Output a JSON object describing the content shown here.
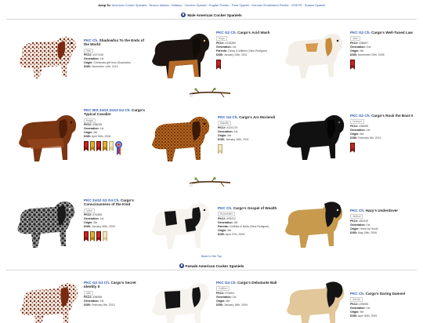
{
  "jump": {
    "label": "Jump To:",
    "links": [
      "American Cocker Spaniels",
      "Bracco Italiano",
      "Brittany",
      "Clumber Spaniel",
      "English Pointer",
      "Field Spaniel",
      "German Shorthaired Pointer",
      "GSDTR",
      "Sussex Spaniel"
    ]
  },
  "sections": {
    "male": {
      "title": "Male American Cocker Spaniels"
    },
    "female": {
      "title": "Female American Cocker Spaniels"
    }
  },
  "back_to_top": "Back to the Top",
  "dogs": [
    {
      "prefix": "PKC Ch.",
      "name": "Shadowfox To the Ends of the World",
      "tag": "Slim",
      "pkc": "#127440",
      "gen": "1st",
      "origin": "Christmas gift from Shadowfox",
      "dob": "December 14th, 2013",
      "parents": ""
    },
    {
      "prefix": "PKC G2 Ch.",
      "name": "Cargo's Acid Wash",
      "tag": "Hugo",
      "pkc": "#128382",
      "gen": "1st",
      "origin": "",
      "dob": "January 24th, 2011",
      "parents": "Ginny & Wilfred (View Pedigree)"
    },
    {
      "prefix": "PKC G2 Ch.",
      "name": "Cargo's Well-Tuned Law",
      "tag": "Jack",
      "pkc": "#38697",
      "gen": "2nd",
      "origin": "Me",
      "dob": "November 29th, 2005",
      "parents": ""
    },
    {
      "prefix": "PKC BIS 2xG2 2xG3 G4 Ch.",
      "name": "Cargo's Typical Cavalier",
      "tag": "Knight",
      "pkc": "#38036",
      "gen": "1st",
      "origin": "Me",
      "dob": "April 26th, 2006",
      "parents": ""
    },
    {
      "prefix": "PKC G4 Ch.",
      "name": "Cargo's Ars Moriendi",
      "tag": "Maudlin",
      "pkc": "#120179",
      "gen": "1st",
      "origin": "Me",
      "dob": "January 16th, 2011",
      "parents": ""
    },
    {
      "prefix": "PKC G2 Ch.",
      "name": "Cargo's Rock the Boat II",
      "tag": "Vermont",
      "pkc": "#38056",
      "gen": "1st",
      "origin": "Me",
      "dob": "February 6th, 2010",
      "parents": ""
    },
    {
      "prefix": "PKC 2xG2 G3 G4 Ch.",
      "name": "Cargo's Consciousness of the Kind",
      "tag": "Icebe",
      "pkc": "#76455",
      "gen": "1st",
      "origin": "Me",
      "dob": "January 30th, 2009",
      "parents": ""
    },
    {
      "prefix": "PKC Ch.",
      "name": "Cargo's Gospel of Wealth",
      "tag": "Rockefeller",
      "pkc": "#53211",
      "gen": "4th",
      "origin": "Me",
      "dob": "April 27th, 2009",
      "parents": "Cedillac & Nella (View Pedigree)"
    },
    {
      "prefix": "PKC Ch.",
      "name": "Hazy's Underdover",
      "tag": "Jettfoot",
      "pkc": "#82349",
      "gen": "1st",
      "origin": "Hired by Hoshi",
      "dob": "May 29th, 2006",
      "parents": ""
    },
    {
      "prefix": "PKC G2 G3 Ch.",
      "name": "Cargo's Secret Identity II",
      "tag": "Alibi",
      "pkc": "#38998",
      "gen": "1st",
      "origin": "",
      "dob": "February 8th, 2013",
      "parents": ""
    },
    {
      "prefix": "PKC G4 Ch.",
      "name": "Cargo's Debutante Ball",
      "tag": "Cotillion",
      "pkc": "#74604",
      "gen": "1st",
      "origin": "Me",
      "dob": "January 16th, 2009",
      "parents": ""
    },
    {
      "prefix": "PKC Ch.",
      "name": "Cargo's Daring Damsel",
      "tag": "Dancer",
      "pkc": "#35055",
      "gen": "1st",
      "origin": "Me",
      "dob": "April 30th, 2009",
      "parents": ""
    }
  ],
  "labels": {
    "pkc": "PKC#:",
    "gen": "Generation:",
    "origin": "Origin:",
    "dob": "DOB:",
    "parents": "Parents:"
  },
  "colors": {
    "link": "#2b55b3",
    "accent": "#2a3b8f"
  }
}
